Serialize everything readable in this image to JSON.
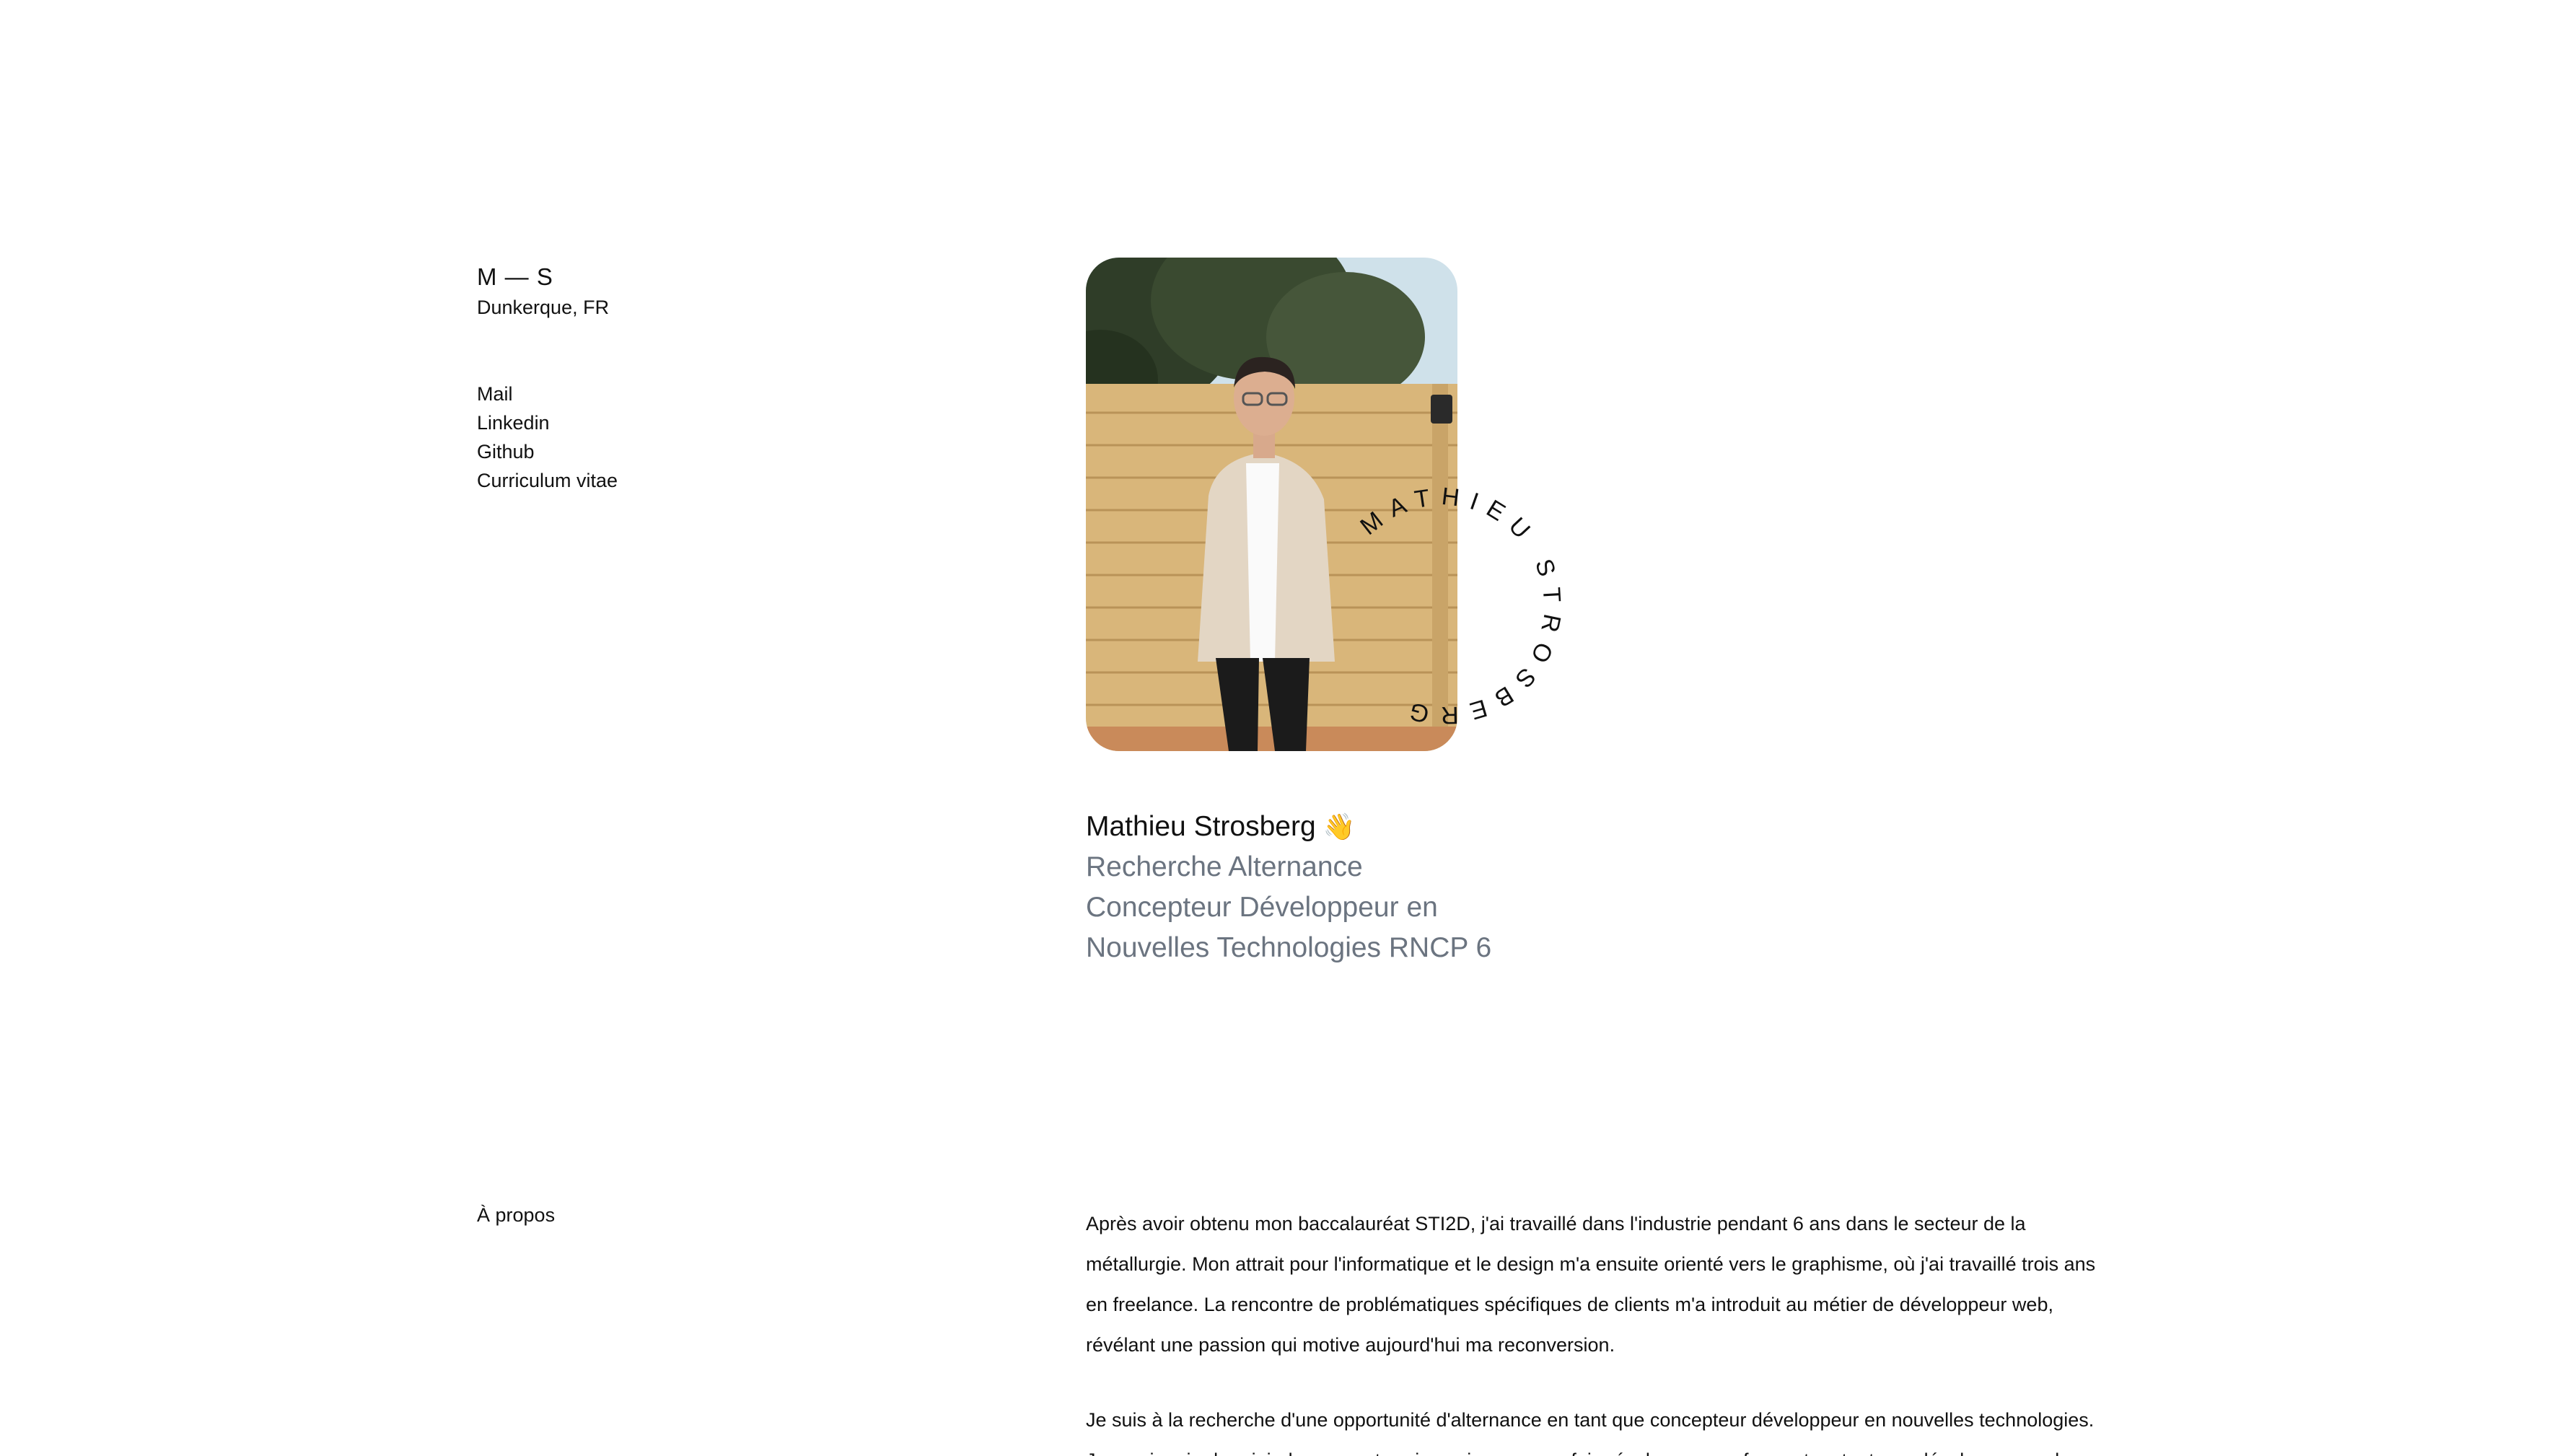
{
  "header": {
    "brand_mark": "M — S",
    "location": "Dunkerque, FR"
  },
  "links": [
    {
      "label": "Mail"
    },
    {
      "label": "Linkedin"
    },
    {
      "label": "Github"
    },
    {
      "label": "Curriculum vitae"
    }
  ],
  "profile": {
    "photo_alt": "Portrait photo of Mathieu Strosberg",
    "circle_text": "MATHIEU STROSBERG",
    "name": "Mathieu Strosberg",
    "wave_emoji": "👋",
    "subtitle_line1": "Recherche Alternance",
    "subtitle_line2": "Concepteur Développeur en",
    "subtitle_line3": "Nouvelles Technologies RNCP 6"
  },
  "about": {
    "label": "À propos",
    "paragraph1": "Après avoir obtenu mon baccalauréat STI2D, j'ai travaillé dans l'industrie pendant 6 ans dans le secteur de la métallurgie. Mon attrait pour l'informatique et le design m'a ensuite orienté vers le graphisme, où j'ai travaillé trois ans en freelance. La rencontre de problématiques spécifiques de clients m'a introduit au métier de développeur web, révélant une passion qui motive aujourd'hui ma reconversion.",
    "paragraph2": "Je suis à la recherche d'une opportunité d'alternance en tant que concepteur développeur en nouvelles technologies. Je serai ravie de rejoindre une entreprise qui pourra me faire évoluer en me formant en tant que développeur web."
  },
  "colors": {
    "background": "#ffffff",
    "text": "#111111",
    "muted": "#6b7480"
  }
}
